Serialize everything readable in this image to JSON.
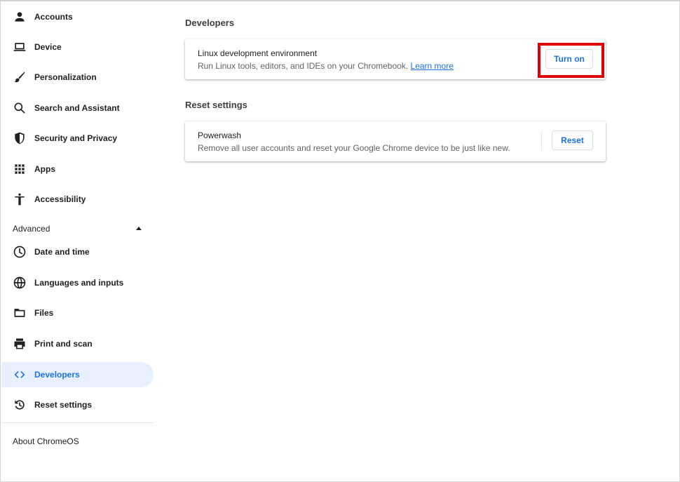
{
  "sidebar": {
    "items": [
      {
        "label": "Accounts",
        "icon": "person-icon"
      },
      {
        "label": "Device",
        "icon": "laptop-icon"
      },
      {
        "label": "Personalization",
        "icon": "brush-icon"
      },
      {
        "label": "Search and Assistant",
        "icon": "search-icon"
      },
      {
        "label": "Security and Privacy",
        "icon": "shield-icon"
      },
      {
        "label": "Apps",
        "icon": "apps-grid-icon"
      },
      {
        "label": "Accessibility",
        "icon": "accessibility-icon"
      }
    ],
    "advanced": {
      "label": "Advanced",
      "expanded": true
    },
    "advanced_items": [
      {
        "label": "Date and time",
        "icon": "clock-icon"
      },
      {
        "label": "Languages and inputs",
        "icon": "globe-icon"
      },
      {
        "label": "Files",
        "icon": "folder-icon"
      },
      {
        "label": "Print and scan",
        "icon": "printer-icon"
      },
      {
        "label": "Developers",
        "icon": "code-icon",
        "active": true
      },
      {
        "label": "Reset settings",
        "icon": "reset-icon"
      }
    ],
    "about": "About ChromeOS"
  },
  "main": {
    "developers": {
      "title": "Developers",
      "card": {
        "title": "Linux development environment",
        "subtitle": "Run Linux tools, editors, and IDEs on your Chromebook.",
        "link": "Learn more",
        "button": "Turn on"
      }
    },
    "reset": {
      "title": "Reset settings",
      "card": {
        "title": "Powerwash",
        "subtitle": "Remove all user accounts and reset your Google Chrome device to be just like new.",
        "button": "Reset"
      }
    }
  },
  "colors": {
    "accent": "#1a73e8",
    "active_bg": "#e8f0fe",
    "highlight": "#e00000"
  }
}
